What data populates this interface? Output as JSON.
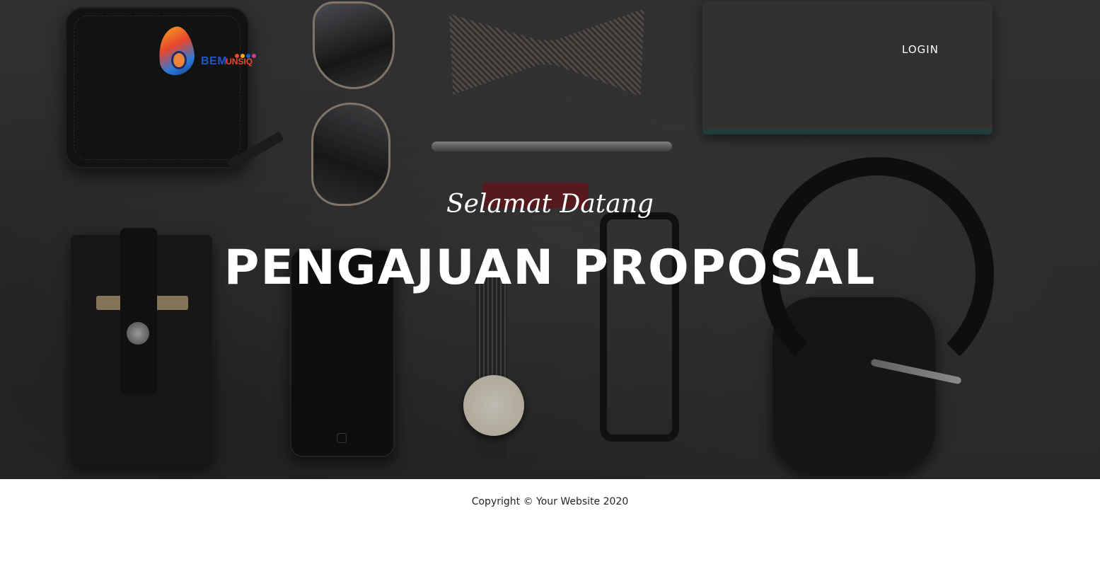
{
  "nav": {
    "logo_text_primary": "BEM",
    "logo_text_secondary": "UNSIQ",
    "logo_colors": [
      "#2256c7",
      "#e84b2a",
      "#f5a623",
      "#2b7bd8"
    ],
    "login_label": "LOGIN"
  },
  "hero": {
    "subheading": "Selamat Datang",
    "heading": "PENGAJUAN PROPOSAL"
  },
  "footer": {
    "copyright": "Copyright © Your Website 2020"
  }
}
